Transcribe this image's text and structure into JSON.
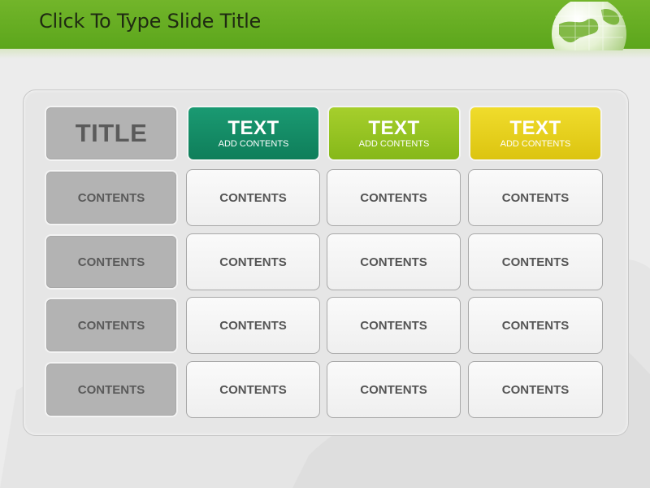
{
  "slide": {
    "title": "Click To Type Slide Title"
  },
  "colors": {
    "header": "#66ad22",
    "teal": "#148a65",
    "lime": "#92c21c",
    "yellow": "#e4ce14",
    "gray_cell": "#b3b3b3"
  },
  "icons": {
    "globe": "globe-icon"
  },
  "table": {
    "title": "TITLE",
    "headers": [
      {
        "label": "TEXT",
        "sub": "ADD CONTENTS"
      },
      {
        "label": "TEXT",
        "sub": "ADD CONTENTS"
      },
      {
        "label": "TEXT",
        "sub": "ADD CONTENTS"
      }
    ],
    "rows": [
      [
        "CONTENTS",
        "CONTENTS",
        "CONTENTS",
        "CONTENTS"
      ],
      [
        "CONTENTS",
        "CONTENTS",
        "CONTENTS",
        "CONTENTS"
      ],
      [
        "CONTENTS",
        "CONTENTS",
        "CONTENTS",
        "CONTENTS"
      ],
      [
        "CONTENTS",
        "CONTENTS",
        "CONTENTS",
        "CONTENTS"
      ]
    ]
  }
}
